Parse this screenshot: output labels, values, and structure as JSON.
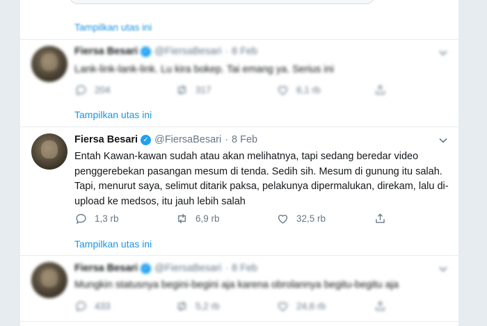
{
  "thread_link_label": "Tampilkan utas ini",
  "tweets": [
    {
      "name": "Fiersa Besari",
      "handle": "@FiersaBesari",
      "date": "8 Feb",
      "text": "Lank-link-lank-link. Lu kira bokep. Tai emang ya. Serius ini",
      "replies": "204",
      "retweets": "317",
      "likes": "6,1 rb"
    },
    {
      "name": "Fiersa Besari",
      "handle": "@FiersaBesari",
      "date": "8 Feb",
      "text": "Entah Kawan-kawan sudah atau akan melihatnya, tapi sedang beredar video penggerebekan pasangan mesum di tenda. Sedih sih. Mesum di gunung itu salah. Tapi, menurut saya, selimut ditarik paksa, pelakunya dipermalukan, direkam, lalu di-upload ke medsos, itu jauh lebih salah",
      "replies": "1,3 rb",
      "retweets": "6,9 rb",
      "likes": "32,5 rb"
    },
    {
      "name": "Fiersa Besari",
      "handle": "@FiersaBesari",
      "date": "8 Feb",
      "text": "Mungkin statusnya begini-begini aja karena obrolannya begitu-begitu aja",
      "replies": "433",
      "retweets": "5,2 rb",
      "likes": "24,6 rb"
    }
  ],
  "colors": {
    "link": "#1b95e0",
    "verified": "#1da1f2",
    "muted": "#657786",
    "text": "#14171a",
    "background": "#e6ecf0"
  },
  "icons": [
    "reply-icon",
    "retweet-icon",
    "like-icon",
    "share-icon",
    "caret-down-icon",
    "verified-badge-icon"
  ]
}
